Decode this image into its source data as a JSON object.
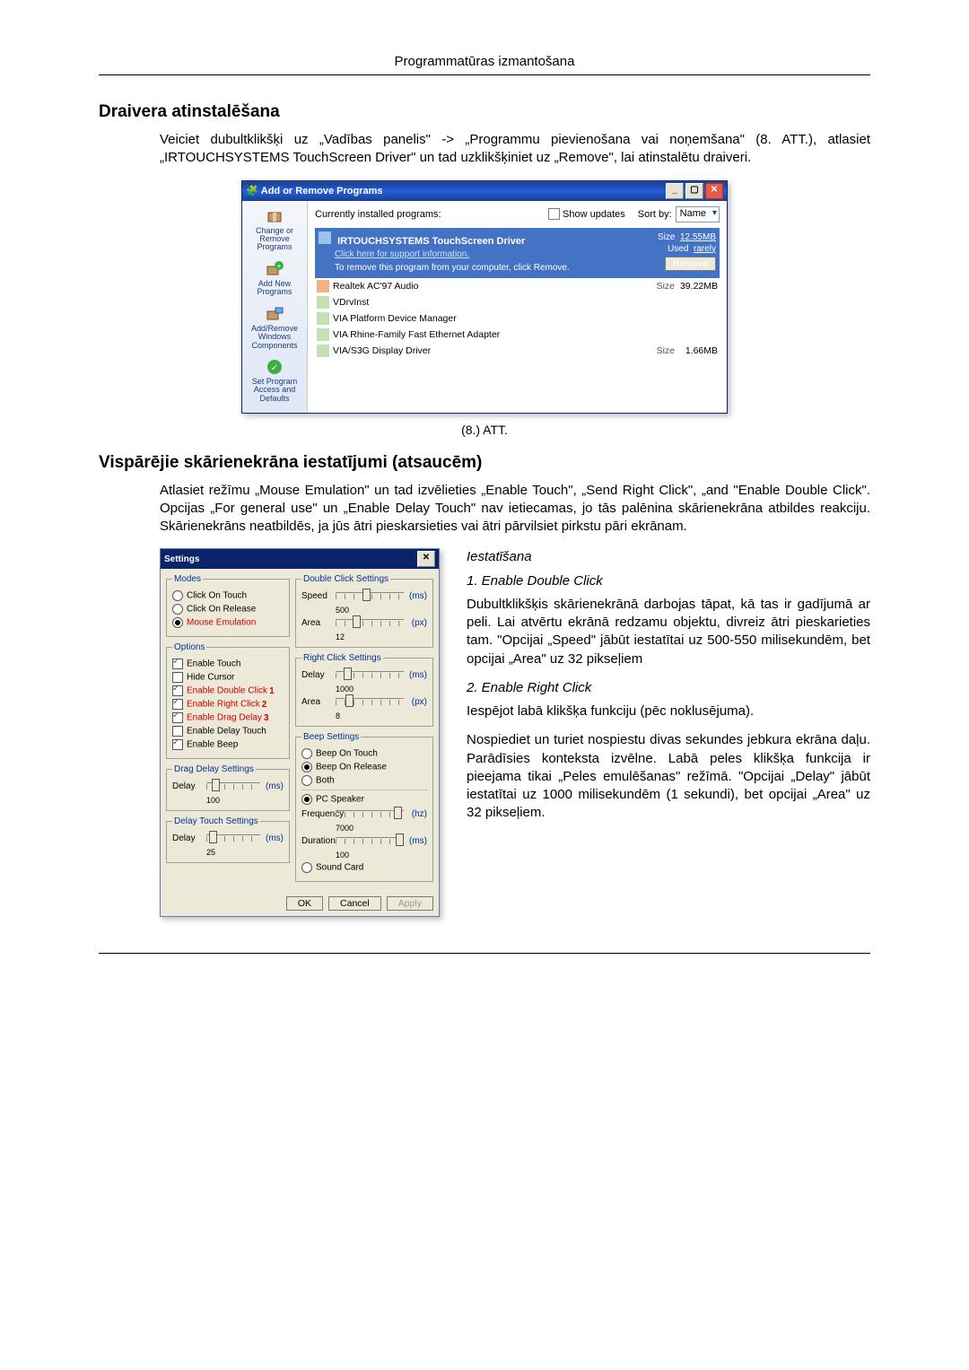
{
  "header": "Programmatūras izmantošana",
  "section1_title": "Draivera atinstalēšana",
  "section1_body": "Veiciet dubultklikšķi uz „Vadības panelis\" -> „Programmu pievienošana vai noņemšana\" (8. ATT.), atlasiet „IRTOUCHSYSTEMS TouchScreen Driver\" un tad uzklikšķiniet uz „Remove\", lai atinstalētu draiveri.",
  "figure1_caption": "(8.) ATT.",
  "arp": {
    "title": "Add or Remove Programs",
    "currently": "Currently installed programs:",
    "show_updates": "Show updates",
    "sort_by": "Sort by:",
    "sort_value": "Name",
    "side": [
      "Change or Remove Programs",
      "Add New Programs",
      "Add/Remove Windows Components",
      "Set Program Access and Defaults"
    ],
    "selected": {
      "name": "IRTOUCHSYSTEMS TouchScreen Driver",
      "support": "Click here for support information.",
      "remove_text": "To remove this program from your computer, click Remove.",
      "size_label": "Size",
      "size_value": "12.55MB",
      "used_label": "Used",
      "used_value": "rarely",
      "remove_btn": "Remove"
    },
    "rows": [
      {
        "name": "Realtek AC'97 Audio",
        "size": "39.22MB"
      },
      {
        "name": "VDrvInst",
        "size": ""
      },
      {
        "name": "VIA Platform Device Manager",
        "size": ""
      },
      {
        "name": "VIA Rhine-Family Fast Ethernet Adapter",
        "size": ""
      },
      {
        "name": "VIA/S3G Display Driver",
        "size": "1.66MB"
      }
    ],
    "size_col": "Size"
  },
  "section2_title": "Vispārējie skārienekrāna iestatījumi (atsaucēm)",
  "section2_body": "Atlasiet režīmu „Mouse Emulation\" un tad izvēlieties „Enable Touch\", „Send Right Click\", „and \"Enable Double Click\". Opcijas „For general use\" un „Enable Delay Touch\" nav ietiecamas, jo tās palēnina skārienekrāna atbildes reakciju. Skārienekrāns neatbildēs, ja jūs ātri pieskarsieties vai ātri pārvilsiet pirkstu pāri ekrānam.",
  "settings": {
    "title": "Settings",
    "groups": {
      "modes": {
        "legend": "Modes",
        "items": [
          "Click On Touch",
          "Click On Release",
          "Mouse Emulation"
        ],
        "selected": 2
      },
      "options": {
        "legend": "Options",
        "items": [
          {
            "label": "Enable Touch",
            "on": true,
            "mark": ""
          },
          {
            "label": "Hide Cursor",
            "on": false,
            "mark": ""
          },
          {
            "label": "Enable Double Click",
            "on": true,
            "mark": "1"
          },
          {
            "label": "Enable Right Click",
            "on": true,
            "mark": "2"
          },
          {
            "label": "Enable Drag Delay",
            "on": true,
            "mark": "3"
          },
          {
            "label": "Enable Delay Touch",
            "on": false,
            "mark": ""
          },
          {
            "label": "Enable Beep",
            "on": true,
            "mark": ""
          }
        ]
      },
      "drag_delay": {
        "legend": "Drag Delay Settings",
        "delay": "100",
        "unit": "(ms)",
        "label": "Delay"
      },
      "delay_touch": {
        "legend": "Delay Touch Settings",
        "delay": "25",
        "unit": "(ms)",
        "label": "Delay"
      },
      "double_click": {
        "legend": "Double Click Settings",
        "speed": "500",
        "area": "12",
        "speed_label": "Speed",
        "area_label": "Area",
        "ms": "(ms)",
        "px": "(px)"
      },
      "right_click": {
        "legend": "Right Click Settings",
        "delay": "1000",
        "area": "8",
        "delay_label": "Delay",
        "area_label": "Area",
        "ms": "(ms)",
        "px": "(px)"
      },
      "beep": {
        "legend": "Beep Settings",
        "items": [
          "Beep On Touch",
          "Beep On Release",
          "Both"
        ],
        "selected": 1,
        "pc": "PC Speaker",
        "freq_label": "Frequency",
        "freq": "7000",
        "freq_unit": "(hz)",
        "dur_label": "Duration",
        "dur": "100",
        "dur_unit": "(ms)",
        "sound": "Sound Card"
      }
    },
    "buttons": {
      "ok": "OK",
      "cancel": "Cancel",
      "apply": "Apply"
    }
  },
  "right": {
    "heading": "Iestatīšana",
    "item1_title": "1. Enable Double Click",
    "item1_body": "Dubultklikšķis skārienekrānā darbojas tāpat, kā tas ir gadījumā ar peli. Lai atvērtu ekrānā redzamu objektu, divreiz ātri pieskarieties tam. \"Opcijai „Speed\" jābūt iestatītai uz 500-550 milisekundēm, bet opcijai „Area\" uz 32 pikseļiem",
    "item2_title": "2. Enable Right Click",
    "item2_body1": "Iespējot labā klikšķa funkciju (pēc noklusējuma).",
    "item2_body2": "Nospiediet un turiet nospiestu divas sekundes jebkura ekrāna daļu. Parādīsies konteksta izvēlne. Labā peles klikšķa funkcija ir pieejama tikai „Peles emulēšanas\" režīmā. \"Opcijai „Delay\" jābūt iestatītai uz 1000 milisekundēm (1 sekundi), bet opcijai „Area\" uz 32 pikseļiem."
  }
}
